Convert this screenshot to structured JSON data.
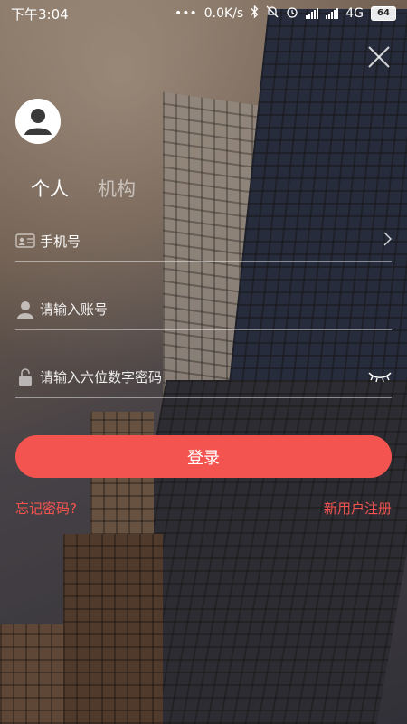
{
  "status_bar": {
    "time": "下午3:04",
    "dots": "•••",
    "speed": "0.0K/s",
    "network": "4G",
    "battery": "64"
  },
  "tabs": [
    {
      "label": "个人",
      "active": true
    },
    {
      "label": "机构",
      "active": false
    }
  ],
  "form": {
    "login_type": "手机号",
    "account_placeholder": "请输入账号",
    "password_placeholder": "请输入六位数字密码"
  },
  "login_button": "登录",
  "links": {
    "forgot": "忘记密码?",
    "register": "新用户注册"
  },
  "colors": {
    "accent": "#f4544f"
  },
  "icons": [
    "close-icon",
    "avatar-icon",
    "id-card-icon",
    "chevron-right-icon",
    "user-icon",
    "lock-icon",
    "eye-closed-icon",
    "bluetooth-icon",
    "mute-icon",
    "alarm-icon"
  ]
}
